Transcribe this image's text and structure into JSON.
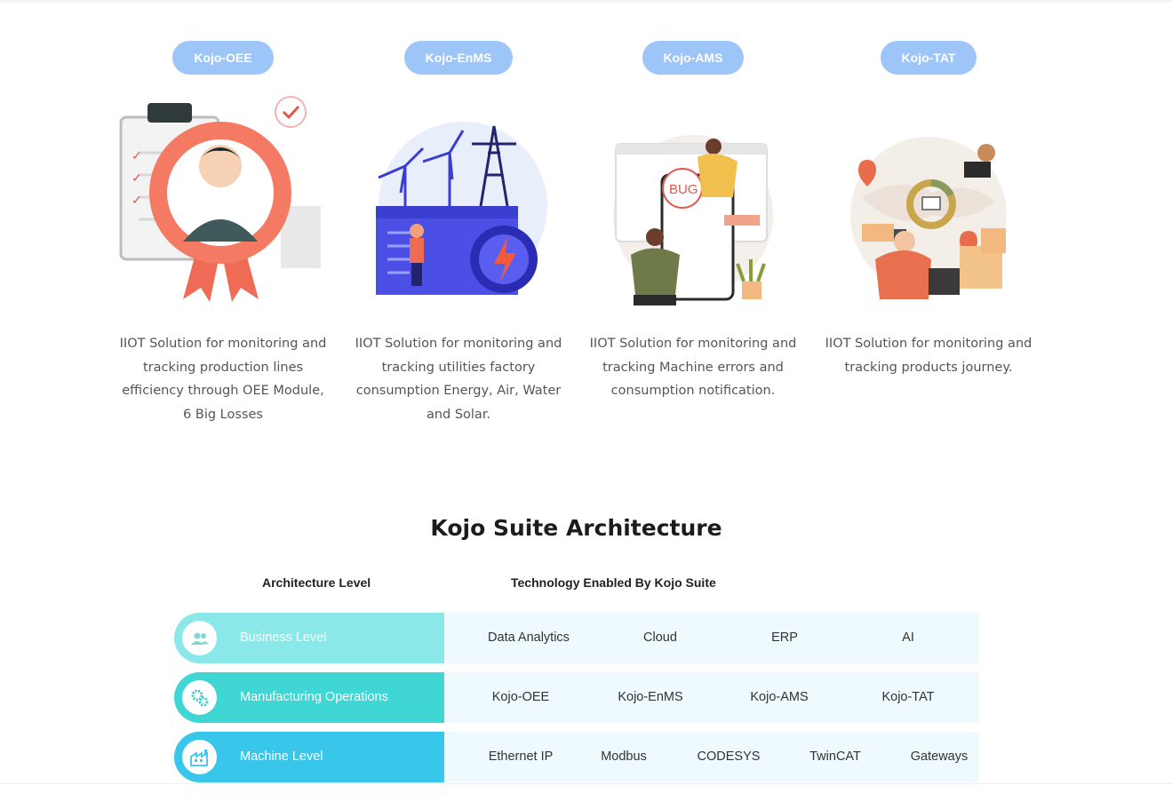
{
  "products": [
    {
      "label": "Kojo-OEE",
      "description": "IIOT Solution for monitoring and tracking production lines efficiency through OEE Module, 6 Big Losses",
      "illustration": "award-ribbon-illustration"
    },
    {
      "label": "Kojo-EnMS",
      "description": "IIOT Solution for monitoring and tracking utilities factory consumption Energy, Air, Water and Solar.",
      "illustration": "energy-wind-power-illustration"
    },
    {
      "label": "Kojo-AMS",
      "description": "IIOT Solution for monitoring and tracking Machine errors and consumption notification.",
      "illustration": "bug-error-illustration"
    },
    {
      "label": "Kojo-TAT",
      "description": "IIOT Solution for monitoring and tracking products journey.",
      "illustration": "logistics-tracking-illustration"
    }
  ],
  "architecture": {
    "title": "Kojo Suite Architecture",
    "col_level": "Architecture Level",
    "col_tech": "Technology Enabled By Kojo Suite",
    "rows": [
      {
        "level": "Business Level",
        "icon": "users-icon",
        "color": "#8ae8e8",
        "tech": [
          "Data Analytics",
          "Cloud",
          "ERP",
          "AI"
        ]
      },
      {
        "level": "Manufacturing Operations",
        "icon": "gears-icon",
        "color": "#3fd6d3",
        "tech": [
          "Kojo-OEE",
          "Kojo-EnMS",
          "Kojo-AMS",
          "Kojo-TAT"
        ]
      },
      {
        "level": "Machine Level",
        "icon": "factory-icon",
        "color": "#38c6ea",
        "tech": [
          "Ethernet IP",
          "Modbus",
          "CODESYS",
          "TwinCAT",
          "Gateways"
        ]
      }
    ]
  },
  "colors": {
    "pill": "#9ec5f7",
    "tech_bg": "#eefafd"
  }
}
